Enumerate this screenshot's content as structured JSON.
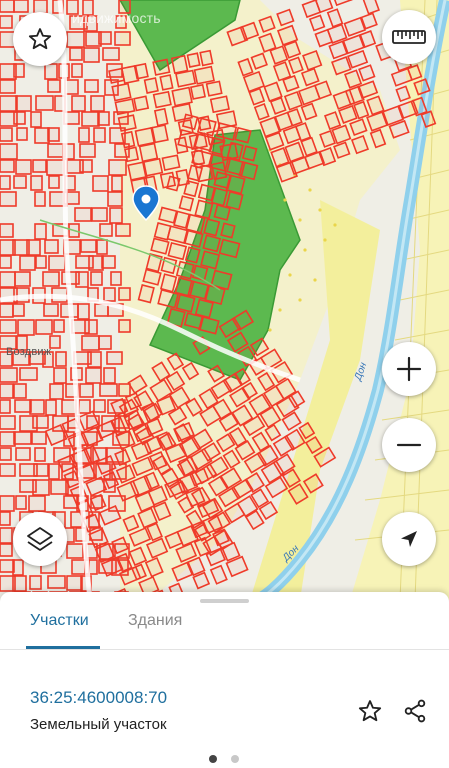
{
  "map": {
    "watermark": "идвижимость",
    "place_label": "Воздвиж",
    "river_label_1": "Дон",
    "river_label_2": "Дон"
  },
  "controls": {
    "favorite": "star-icon",
    "ruler": "ruler-icon",
    "zoom_in": "plus-icon",
    "zoom_out": "minus-icon",
    "layers": "layers-icon",
    "location": "navigation-arrow-icon"
  },
  "sheet": {
    "tabs": [
      {
        "label": "Участки",
        "active": true
      },
      {
        "label": "Здания",
        "active": false
      }
    ],
    "parcel": {
      "cadastral_number": "36:25:4600008:70",
      "type": "Земельный участок"
    },
    "pager": {
      "count": 2,
      "active": 0
    }
  },
  "colors": {
    "accent": "#1f6f9e",
    "parcel_border": "#ef3b2a",
    "green_area": "#5cb94f",
    "yellow_area": "#f3ef9c",
    "river": "#8fd0ec"
  }
}
